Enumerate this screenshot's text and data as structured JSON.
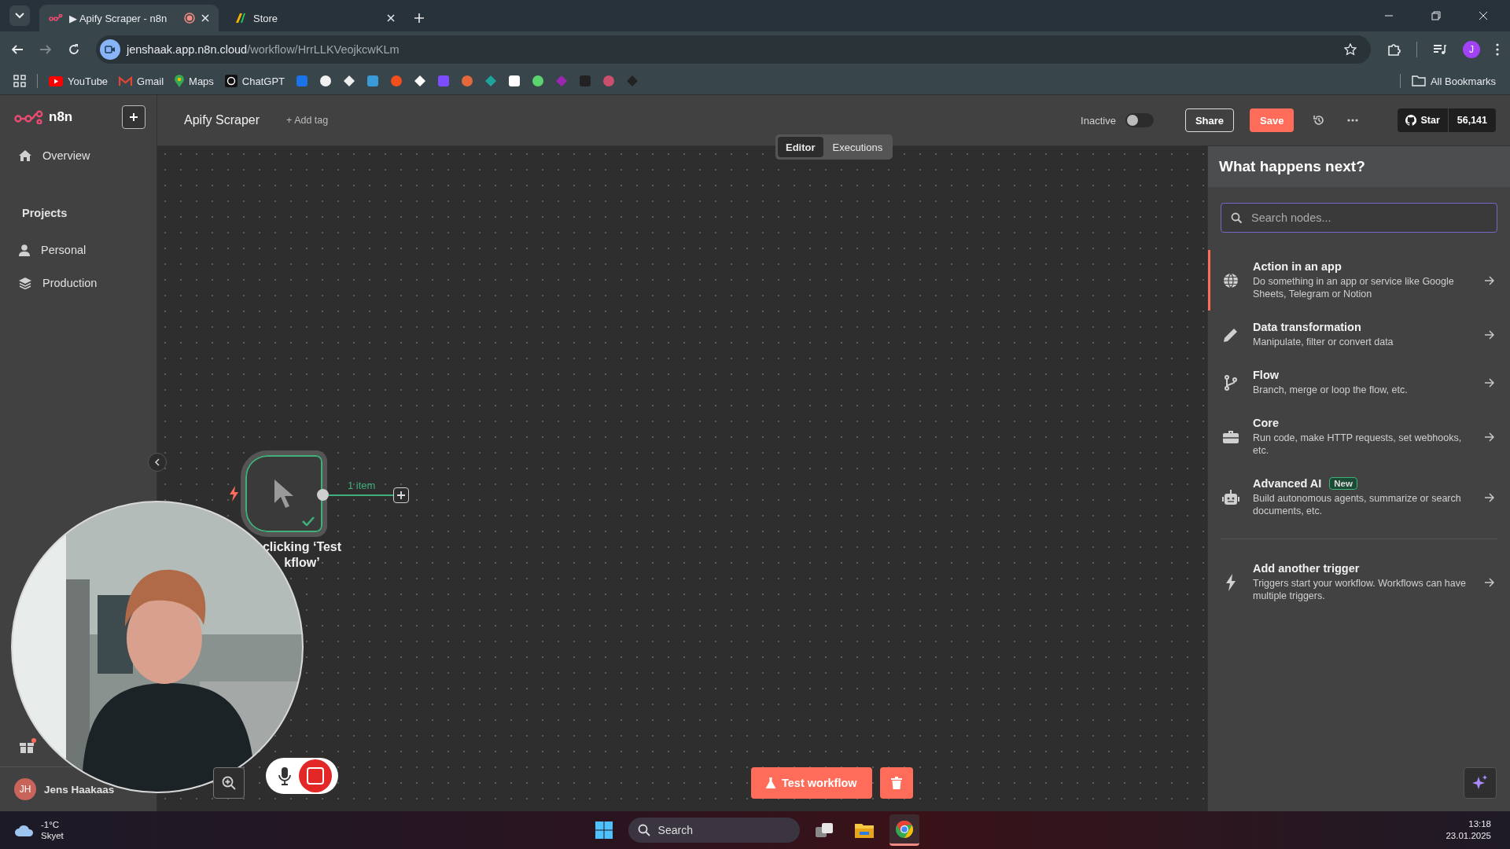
{
  "browser": {
    "tabs": [
      {
        "title": "▶ Apify Scraper - n8n",
        "selected": true,
        "recording": true
      },
      {
        "title": "Store",
        "selected": false,
        "recording": false
      }
    ],
    "url": {
      "host": "jenshaak.app.n8n.cloud",
      "path": "/workflow/HrrLLKVeojkcwKLm"
    },
    "profile_initial": "J",
    "bookmarks": [
      {
        "label": "YouTube"
      },
      {
        "label": "Gmail"
      },
      {
        "label": "Maps"
      },
      {
        "label": "ChatGPT"
      }
    ],
    "all_bookmarks": "All Bookmarks"
  },
  "sidebar": {
    "logo": "n8n",
    "items": [
      {
        "label": "Overview"
      }
    ],
    "projects_heading": "Projects",
    "projects": [
      {
        "label": "Personal"
      },
      {
        "label": "Production"
      }
    ],
    "user": {
      "initials": "JH",
      "name": "Jens Haakaas"
    }
  },
  "header": {
    "workflow_name": "Apify Scraper",
    "add_tag": "+ Add tag",
    "active_toggle": {
      "label": "Inactive",
      "on": false
    },
    "share": "Share",
    "save": "Save",
    "github": {
      "label": "Star",
      "count": "56,141"
    }
  },
  "view_tabs": [
    {
      "label": "Editor",
      "selected": true
    },
    {
      "label": "Executions",
      "selected": false
    }
  ],
  "canvas": {
    "node": {
      "label_lines": [
        "clicking ‘Test",
        "kflow’"
      ],
      "executed": true
    },
    "connection_label": "1 item",
    "test_button": "Test workflow"
  },
  "panel": {
    "title": "What happens next?",
    "search": {
      "placeholder": "Search nodes..."
    },
    "items": [
      {
        "title": "Action in an app",
        "description": "Do something in an app or service like Google Sheets, Telegram or Notion",
        "selected": true
      },
      {
        "title": "Data transformation",
        "description": "Manipulate, filter or convert data",
        "selected": false
      },
      {
        "title": "Flow",
        "description": "Branch, merge or loop the flow, etc.",
        "selected": false
      },
      {
        "title": "Core",
        "description": "Run code, make HTTP requests, set webhooks, etc.",
        "selected": false
      },
      {
        "title": "Advanced AI",
        "badge": "New",
        "description": "Build autonomous agents, summarize or search documents, etc.",
        "selected": false
      }
    ],
    "trigger": {
      "title": "Add another trigger",
      "description": "Triggers start your workflow. Workflows can have multiple triggers."
    }
  },
  "taskbar": {
    "weather": {
      "temperature": "-1°C",
      "condition": "Skyet"
    },
    "search": "Search",
    "time": "13:18",
    "date": "23.01.2025"
  }
}
